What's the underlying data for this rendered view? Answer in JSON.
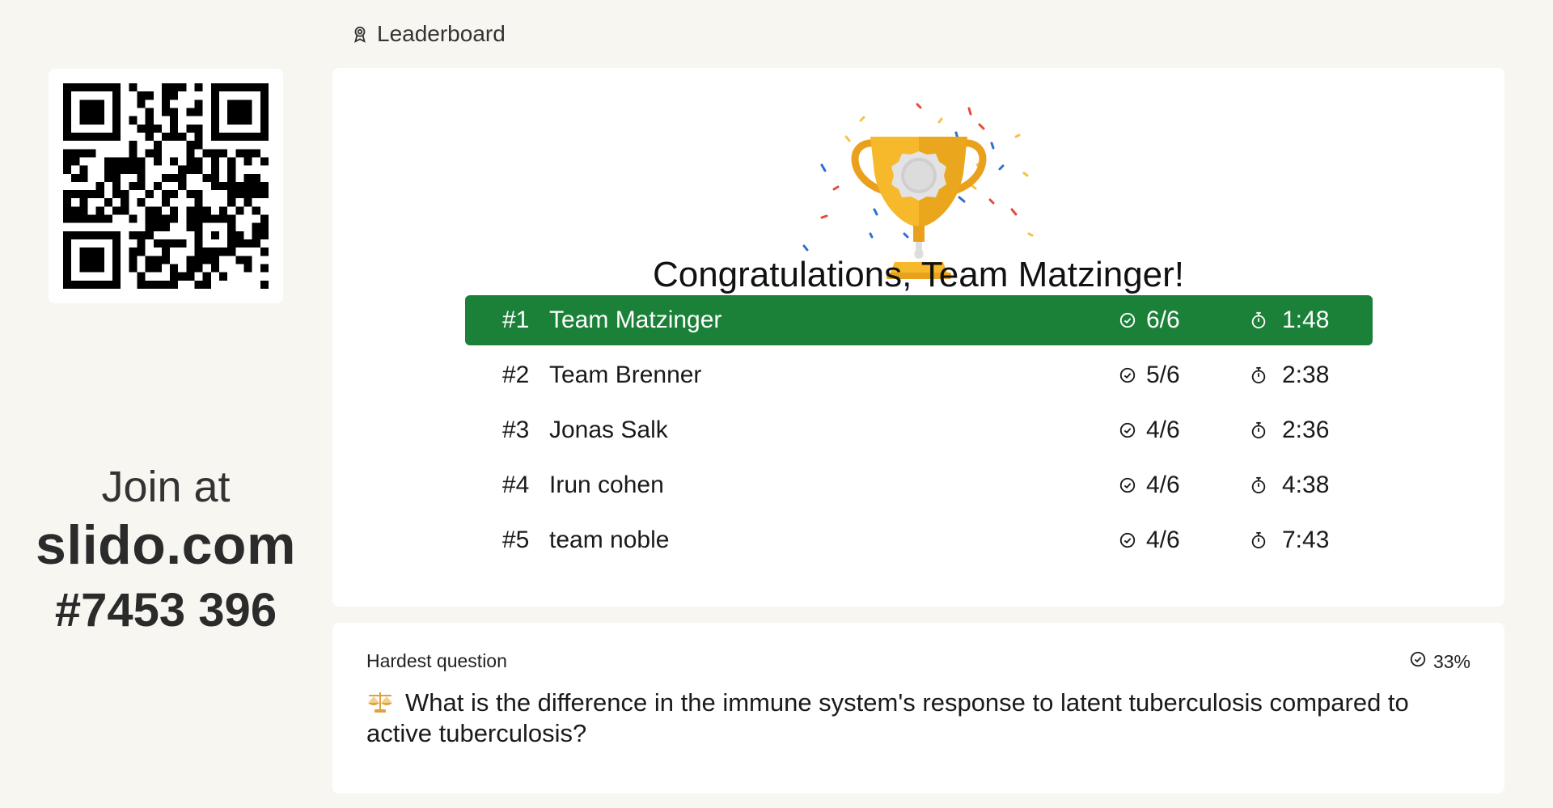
{
  "header": {
    "title": "Leaderboard",
    "icon": "award-icon"
  },
  "join": {
    "label": "Join at",
    "url": "slido.com",
    "code": "#7453 396"
  },
  "leaderboard": {
    "congrats": "Congratulations, Team Matzinger!",
    "rows": [
      {
        "rank": "#1",
        "name": "Team Matzinger",
        "score": "6/6",
        "time": "1:48"
      },
      {
        "rank": "#2",
        "name": "Team Brenner",
        "score": "5/6",
        "time": "2:38"
      },
      {
        "rank": "#3",
        "name": "Jonas Salk",
        "score": "4/6",
        "time": "2:36"
      },
      {
        "rank": "#4",
        "name": "Irun cohen",
        "score": "4/6",
        "time": "4:38"
      },
      {
        "rank": "#5",
        "name": "team noble",
        "score": "4/6",
        "time": "7:43"
      }
    ],
    "icons": {
      "score": "check-circle-icon",
      "time": "stopwatch-icon"
    }
  },
  "hardest_question": {
    "label": "Hardest question",
    "percent": "33%",
    "icon": "scales-icon",
    "text": "What is the difference in the immune system's response to latent tuberculosis compared to active tuberculosis?"
  },
  "colors": {
    "winner": "#1b8139",
    "background": "#f8f6f1",
    "trophy": "#f6b92b"
  }
}
